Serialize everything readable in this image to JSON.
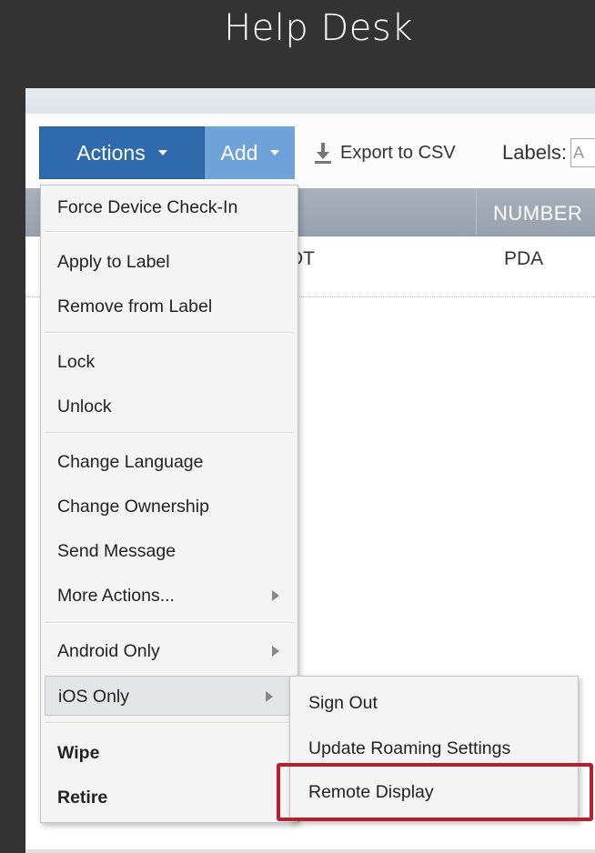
{
  "slide_title": "Help Desk",
  "toolbar": {
    "actions_label": "Actions",
    "add_label": "Add",
    "export_label": "Export to CSV",
    "labels_label": "Labels:",
    "labels_input_value": "A"
  },
  "table": {
    "columns": [
      "NUMBER"
    ],
    "rows": [
      [
        "DT",
        "PDA"
      ]
    ]
  },
  "actions_menu": {
    "items": [
      {
        "label": "Force Device Check-In"
      },
      {
        "label": "Apply to Label"
      },
      {
        "label": "Remove from Label"
      },
      {
        "label": "Lock"
      },
      {
        "label": "Unlock"
      },
      {
        "label": "Change Language"
      },
      {
        "label": "Change Ownership"
      },
      {
        "label": "Send Message"
      },
      {
        "label": "More Actions...",
        "submenu": true
      },
      {
        "label": "Android Only",
        "submenu": true
      },
      {
        "label": "iOS Only",
        "submenu": true,
        "highlighted": true
      },
      {
        "label": "Wipe",
        "bold": true
      },
      {
        "label": "Retire",
        "bold": true
      }
    ]
  },
  "ios_submenu": {
    "items": [
      {
        "label": "Sign Out"
      },
      {
        "label": "Update Roaming Settings"
      },
      {
        "label": "Remote Display",
        "annotated": true
      }
    ]
  },
  "colors": {
    "background": "#333333",
    "actions_button": "#2e6aac",
    "add_button": "#6fa2d8",
    "table_header": "#a0abb6",
    "annotation_box": "#b51f2e"
  }
}
